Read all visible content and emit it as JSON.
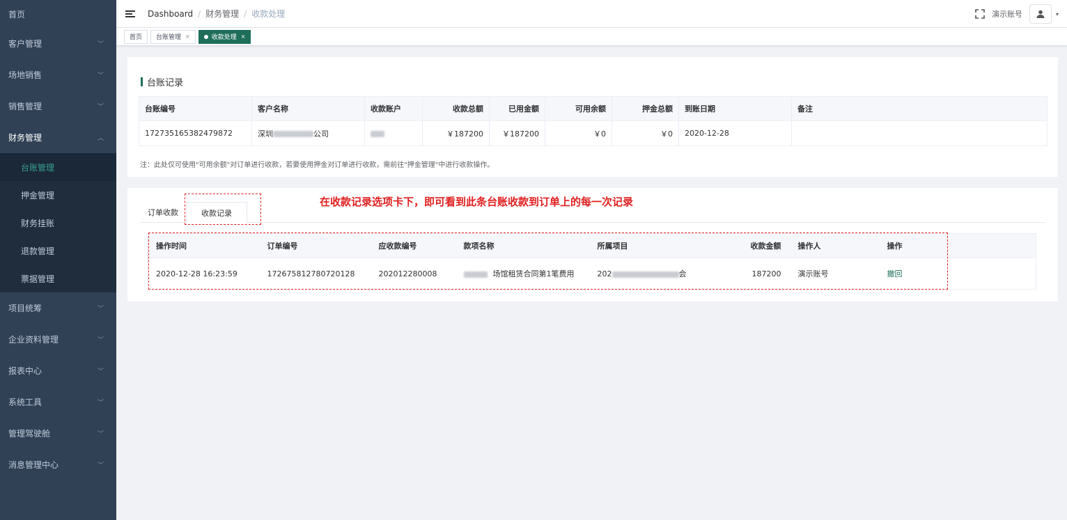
{
  "sidebar": {
    "items": [
      {
        "label": "首页",
        "chevron": ""
      },
      {
        "label": "客户管理",
        "chevron": "﹀"
      },
      {
        "label": "场地销售",
        "chevron": "﹀"
      },
      {
        "label": "销售管理",
        "chevron": "﹀"
      },
      {
        "label": "财务管理",
        "chevron": "︿"
      },
      {
        "label": "项目统筹",
        "chevron": "﹀"
      },
      {
        "label": "企业资料管理",
        "chevron": "﹀"
      },
      {
        "label": "报表中心",
        "chevron": "﹀"
      },
      {
        "label": "系统工具",
        "chevron": "﹀"
      },
      {
        "label": "管理驾驶舱",
        "chevron": "﹀"
      },
      {
        "label": "消息管理中心",
        "chevron": "﹀"
      }
    ],
    "finance_sub": [
      "台账管理",
      "押金管理",
      "财务挂账",
      "退款管理",
      "票据管理"
    ]
  },
  "navbar": {
    "breadcrumb": [
      "Dashboard",
      "财务管理",
      "收款处理"
    ],
    "separator": "/",
    "user_name": "演示账号",
    "caret": "▾"
  },
  "tags": [
    {
      "label": "首页",
      "close": ""
    },
    {
      "label": "台账管理",
      "close": "×"
    },
    {
      "label": "收款处理",
      "close": "×"
    }
  ],
  "ledger": {
    "title": "台账记录",
    "columns": [
      "台账编号",
      "客户名称",
      "收款账户",
      "收款总额",
      "已用金额",
      "可用余额",
      "押金总额",
      "到账日期",
      "备注"
    ],
    "row": {
      "id": "172735165382479872",
      "customer_prefix": "深圳",
      "customer_suffix": "公司",
      "account": "",
      "total": "￥187200",
      "used": "￥187200",
      "available": "￥0",
      "deposit": "￥0",
      "date": "2020-12-28",
      "remark": ""
    },
    "note": "注：此处仅可使用\"可用余额\"对订单进行收款，若要使用押金对订单进行收款，需前往\"押金管理\"中进行收款操作。"
  },
  "records": {
    "tabs": [
      "订单收款",
      "收款记录"
    ],
    "annotation": "在收款记录选项卡下，即可看到此条台账收款到订单上的每一次记录",
    "columns": [
      "操作时间",
      "订单编号",
      "应收款编号",
      "款项名称",
      "所属项目",
      "收款金额",
      "操作人",
      "操作"
    ],
    "row": {
      "time": "2020-12-28 16:23:59",
      "order_no": "172675812780720128",
      "receivable_no": "202012280008",
      "item_name": "场馆租赁合同第1笔费用",
      "project_prefix": "202",
      "project_suffix": "会",
      "amount": "187200",
      "operator": "演示账号",
      "action": "撤回"
    }
  },
  "colors": {
    "accent": "#1e6e5a",
    "sidebar": "#304156",
    "annotation": "#e02020"
  }
}
